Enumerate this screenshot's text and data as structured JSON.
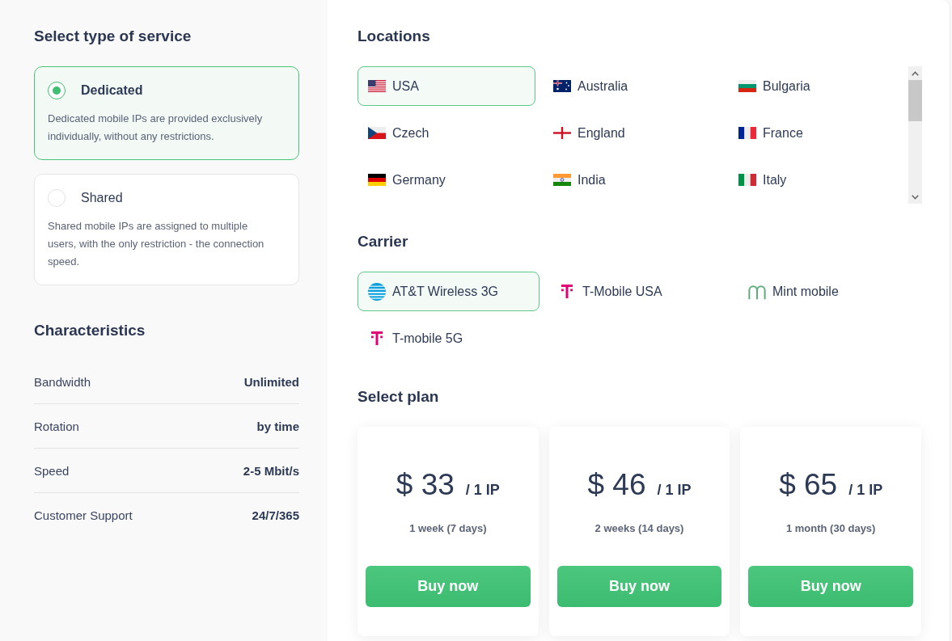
{
  "service_type": {
    "title": "Select type of service",
    "options": [
      {
        "name": "Dedicated",
        "description": "Dedicated mobile IPs are provided exclusively individually, without any restrictions.",
        "selected": true
      },
      {
        "name": "Shared",
        "description": "Shared mobile IPs are assigned to multiple users, with the only restriction - the connection speed.",
        "selected": false
      }
    ]
  },
  "characteristics": {
    "title": "Characteristics",
    "rows": [
      {
        "label": "Bandwidth",
        "value": "Unlimited"
      },
      {
        "label": "Rotation",
        "value": "by time"
      },
      {
        "label": "Speed",
        "value": "2-5 Mbit/s"
      },
      {
        "label": "Customer Support",
        "value": "24/7/365"
      }
    ]
  },
  "locations": {
    "title": "Locations",
    "items": [
      {
        "name": "USA",
        "kind": "us",
        "selected": true
      },
      {
        "name": "Australia",
        "kind": "au",
        "selected": false
      },
      {
        "name": "Bulgaria",
        "kind": "bg",
        "selected": false
      },
      {
        "name": "Czech",
        "kind": "cz",
        "selected": false
      },
      {
        "name": "England",
        "kind": "en",
        "selected": false
      },
      {
        "name": "France",
        "kind": "fr",
        "selected": false
      },
      {
        "name": "Germany",
        "kind": "de",
        "selected": false
      },
      {
        "name": "India",
        "kind": "in",
        "selected": false
      },
      {
        "name": "Italy",
        "kind": "it",
        "selected": false
      }
    ]
  },
  "carrier": {
    "title": "Carrier",
    "items": [
      {
        "name": "AT&T Wireless 3G",
        "kind": "globe",
        "selected": true
      },
      {
        "name": "T-Mobile USA",
        "kind": "t",
        "selected": false
      },
      {
        "name": "Mint mobile",
        "kind": "m",
        "selected": false
      },
      {
        "name": "T-mobile 5G",
        "kind": "t",
        "selected": false
      }
    ]
  },
  "plans": {
    "title": "Select plan",
    "items": [
      {
        "price": "$ 33",
        "unit": "/ 1 IP",
        "duration": "1 week (7 days)",
        "button": "Buy now"
      },
      {
        "price": "$ 46",
        "unit": "/ 1 IP",
        "duration": "2 weeks (14 days)",
        "button": "Buy now"
      },
      {
        "price": "$ 65",
        "unit": "/ 1 IP",
        "duration": "1 month (30 days)",
        "button": "Buy now"
      }
    ]
  }
}
